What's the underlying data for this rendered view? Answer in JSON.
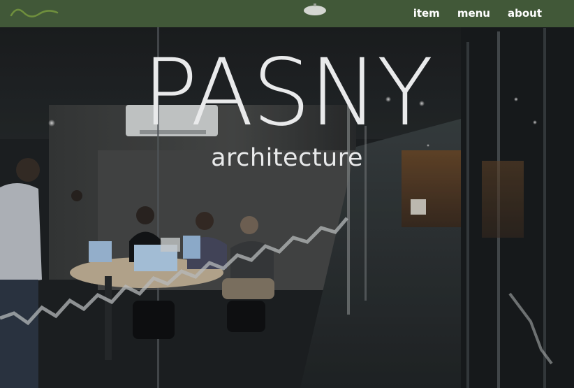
{
  "brand": {
    "title": "PASNY",
    "subtitle": "architecture"
  },
  "nav": {
    "items": [
      {
        "label": "item"
      },
      {
        "label": "menu"
      },
      {
        "label": "about"
      }
    ]
  },
  "icons": {
    "logo": "wave-logo-icon"
  },
  "colors": {
    "navbar_bg": "#445c3a",
    "nav_text": "#ffffff",
    "hero_text": "#e9eaeb",
    "logo_stroke": "#6f8f3d"
  }
}
